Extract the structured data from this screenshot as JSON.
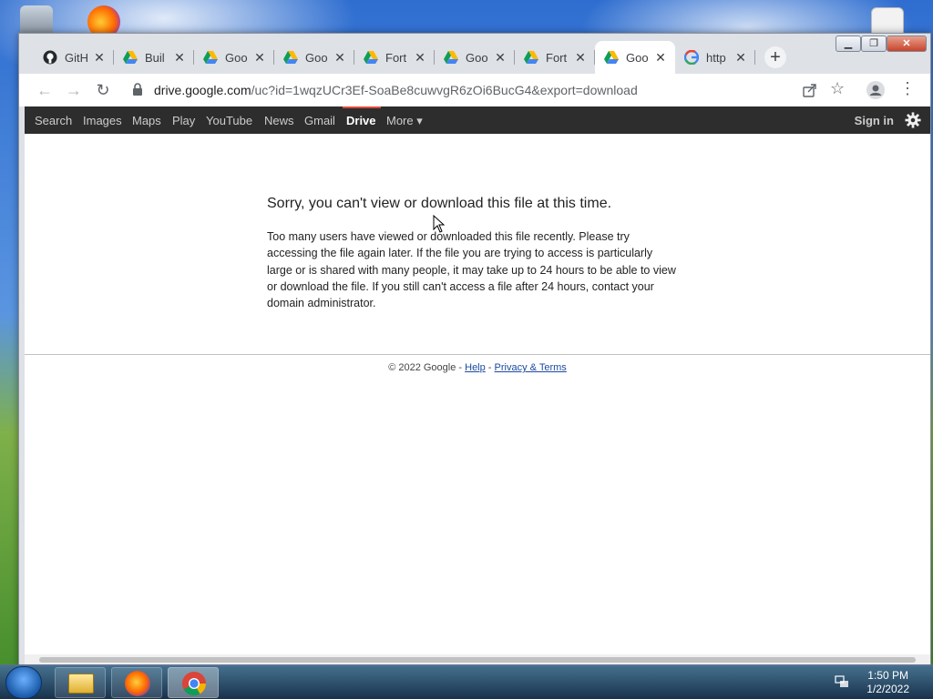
{
  "browser": {
    "tabs": [
      {
        "title": "GitH",
        "favicon": "github-icon"
      },
      {
        "title": "Buil",
        "favicon": "google-drive-icon"
      },
      {
        "title": "Goo",
        "favicon": "google-drive-icon"
      },
      {
        "title": "Goo",
        "favicon": "google-drive-icon"
      },
      {
        "title": "Fort",
        "favicon": "google-drive-icon"
      },
      {
        "title": "Goo",
        "favicon": "google-drive-icon"
      },
      {
        "title": "Fort",
        "favicon": "google-drive-icon"
      },
      {
        "title": "Goo",
        "favicon": "google-drive-icon",
        "active": true
      },
      {
        "title": "http",
        "favicon": "google-icon"
      }
    ],
    "address": {
      "domain": "drive.google.com",
      "path": "/uc?id=1wqzUCr3Ef-SoaBe8cuwvgR6zOi6BucG4&export=download"
    }
  },
  "google_bar": {
    "items": [
      "Search",
      "Images",
      "Maps",
      "Play",
      "YouTube",
      "News",
      "Gmail",
      "Drive",
      "More ▾"
    ],
    "active": "Drive",
    "sign_in": "Sign in"
  },
  "page": {
    "title": "Sorry, you can't view or download this file at this time.",
    "body": "Too many users have viewed or downloaded this file recently. Please try accessing the file again later. If the file you are trying to access is particularly large or is shared with many people, it may take up to 24 hours to be able to view or download the file. If you still can't access a file after 24 hours, contact your domain administrator.",
    "footer": {
      "copyright": "© 2022 Google - ",
      "help": "Help",
      "sep": " - ",
      "privacy": "Privacy & Terms"
    }
  },
  "taskbar": {
    "apps": [
      "file-explorer-icon",
      "firefox-icon",
      "chrome-icon"
    ],
    "time": "1:50 PM",
    "date": "1/2/2022"
  },
  "colors": {
    "gbar_bg": "#2d2d2d",
    "gbar_active_accent": "#dd4b39",
    "link": "#1a4aa0"
  }
}
